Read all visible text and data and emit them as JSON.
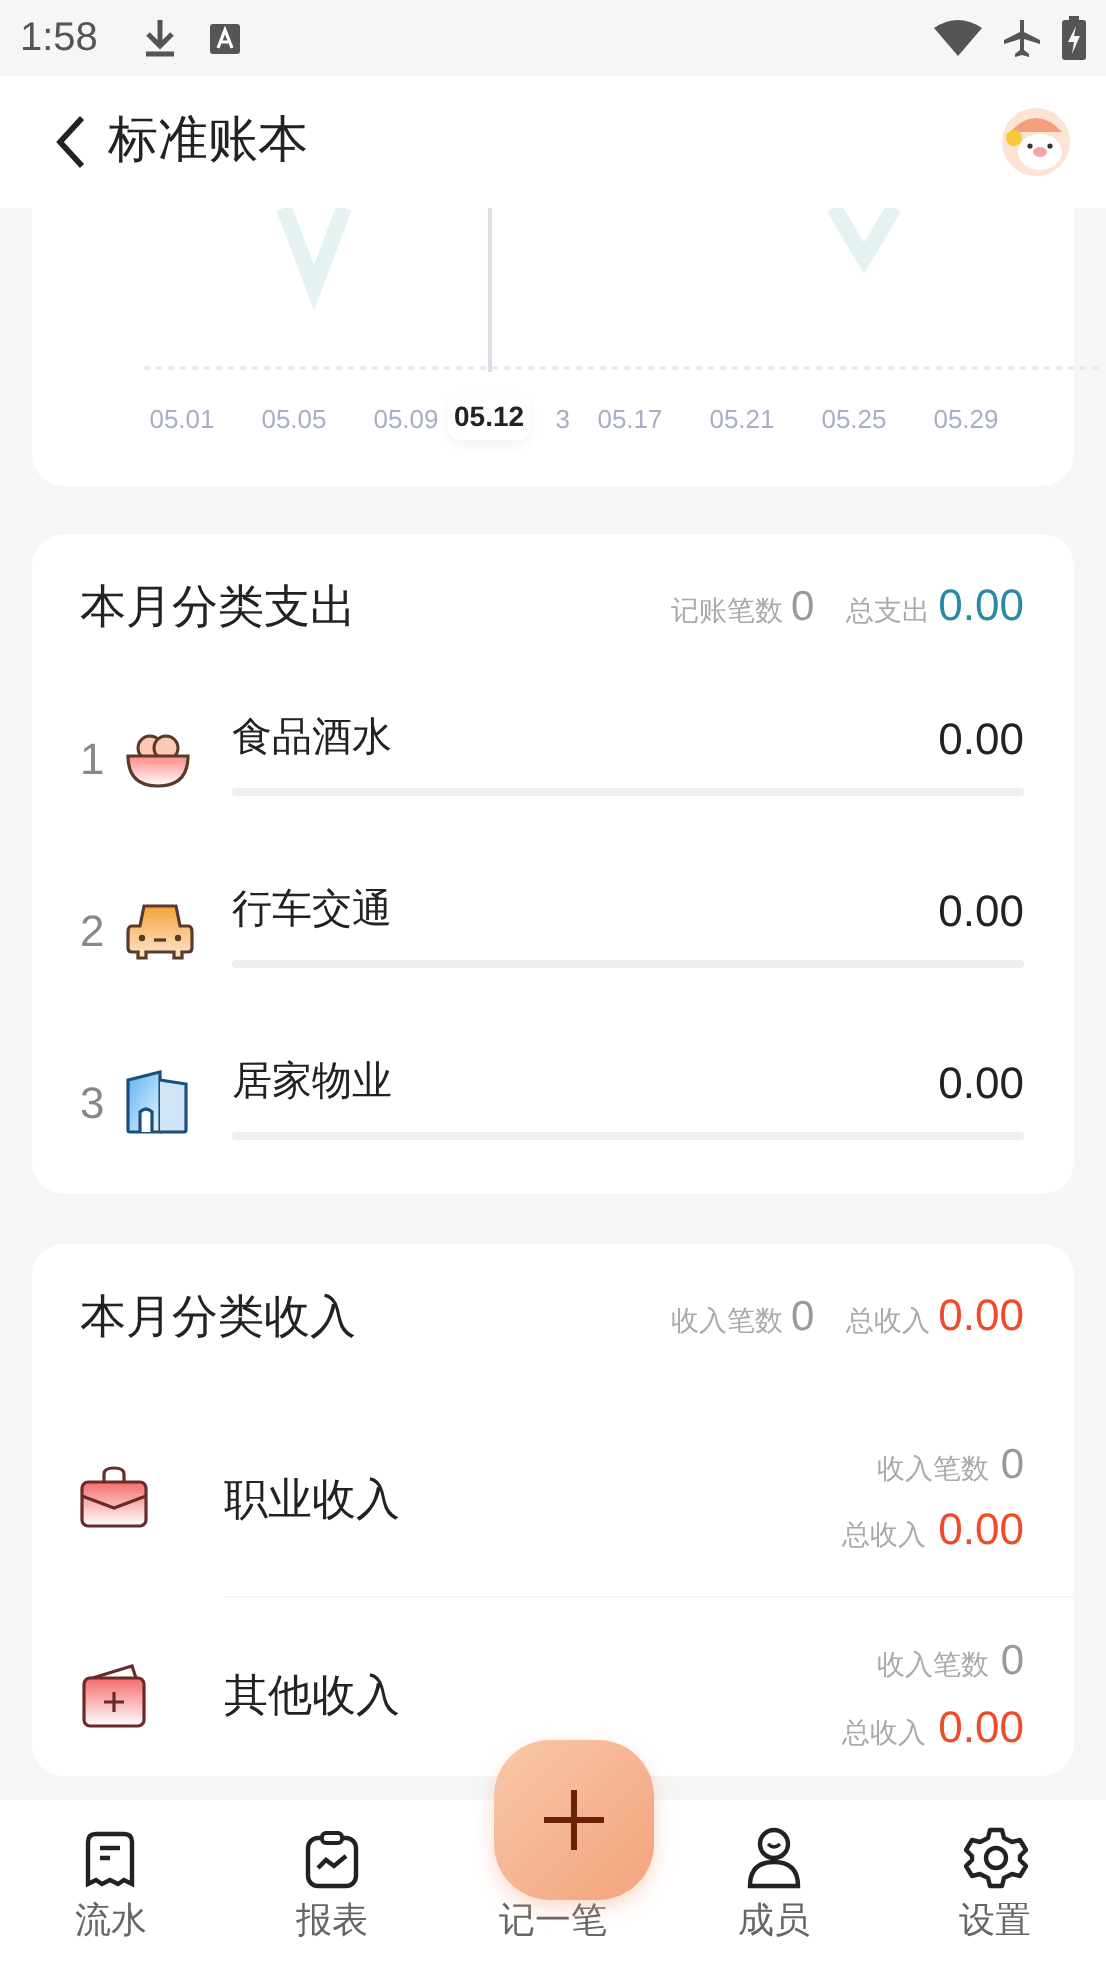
{
  "status_bar": {
    "time": "1:58"
  },
  "header": {
    "title": "标准账本"
  },
  "chart": {
    "x_labels": [
      {
        "label": "05.01",
        "clipped": false
      },
      {
        "label": "05.05",
        "clipped": false
      },
      {
        "label": "05.09",
        "clipped": false
      },
      {
        "label": "3",
        "clipped": true
      },
      {
        "label": "05.17",
        "clipped": false
      },
      {
        "label": "05.21",
        "clipped": false
      },
      {
        "label": "05.25",
        "clipped": false
      },
      {
        "label": "05.29",
        "clipped": false
      }
    ],
    "cursor_label": "05.12"
  },
  "expense": {
    "title": "本月分类支出",
    "count_label": "记账笔数",
    "count": "0",
    "total_label": "总支出",
    "total": "0.00",
    "rows": [
      {
        "rank": "1",
        "kind": "food",
        "name": "食品酒水",
        "amount": "0.00"
      },
      {
        "rank": "2",
        "kind": "car",
        "name": "行车交通",
        "amount": "0.00"
      },
      {
        "rank": "3",
        "kind": "home",
        "name": "居家物业",
        "amount": "0.00"
      }
    ]
  },
  "income": {
    "title": "本月分类收入",
    "count_label": "收入笔数",
    "count": "0",
    "total_label": "总收入",
    "total": "0.00",
    "rows": [
      {
        "kind": "briefcase",
        "name": "职业收入",
        "count_label": "收入笔数",
        "count": "0",
        "total_label": "总收入",
        "total": "0.00"
      },
      {
        "kind": "wallet",
        "name": "其他收入",
        "count_label": "收入笔数",
        "count": "0",
        "total_label": "总收入",
        "total": "0.00"
      }
    ]
  },
  "nav": [
    {
      "kind": "list",
      "label": "流水"
    },
    {
      "kind": "report",
      "label": "报表"
    },
    {
      "kind": "add",
      "label": "记一笔"
    },
    {
      "kind": "member",
      "label": "成员"
    },
    {
      "kind": "settings",
      "label": "设置"
    }
  ]
}
